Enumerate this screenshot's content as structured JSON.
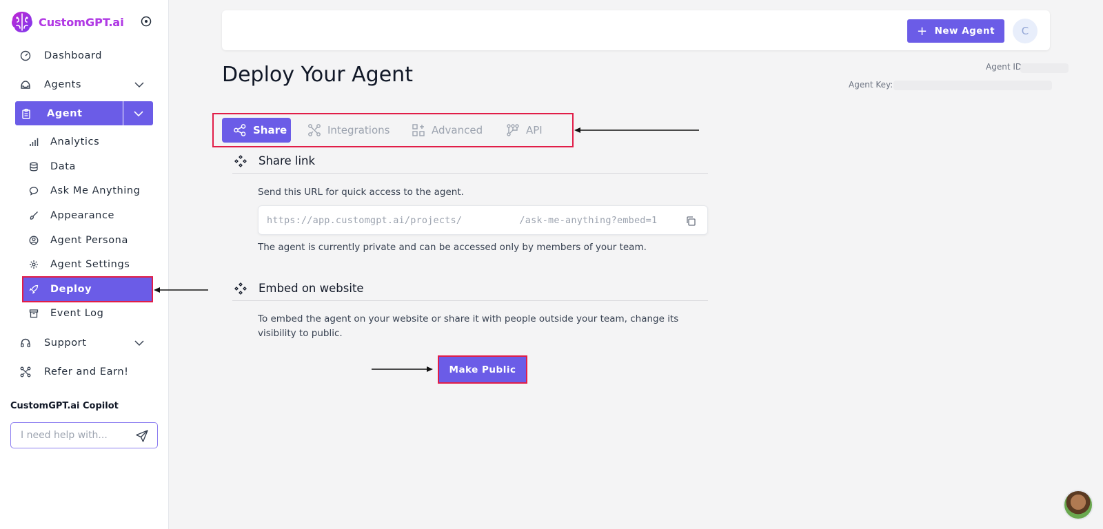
{
  "app": {
    "name": "CustomGPT.ai"
  },
  "sidebar": {
    "items": [
      {
        "label": "Dashboard",
        "icon": "dashboard-icon"
      },
      {
        "label": "Agents",
        "icon": "agents-icon"
      },
      {
        "label": "Agent",
        "icon": "clipboard-icon"
      },
      {
        "label": "Support",
        "icon": "headset-icon"
      },
      {
        "label": "Refer and Earn!",
        "icon": "share-nodes-icon"
      }
    ],
    "subitems": [
      {
        "label": "Analytics",
        "icon": "bar-chart-icon"
      },
      {
        "label": "Data",
        "icon": "database-icon"
      },
      {
        "label": "Ask Me Anything",
        "icon": "chat-bubble-icon"
      },
      {
        "label": "Appearance",
        "icon": "brush-icon"
      },
      {
        "label": "Agent Persona",
        "icon": "user-circle-icon"
      },
      {
        "label": "Agent Settings",
        "icon": "gear-icon"
      },
      {
        "label": "Deploy",
        "icon": "rocket-icon",
        "active": true
      },
      {
        "label": "Event Log",
        "icon": "archive-icon"
      }
    ],
    "copilot": {
      "title": "CustomGPT.ai Copilot",
      "placeholder": "I need help with..."
    }
  },
  "header": {
    "new_agent_label": "New Agent",
    "avatar_initial": "C"
  },
  "page": {
    "title": "Deploy Your Agent",
    "agent_id_label": "Agent ID",
    "agent_key_label": "Agent Key:"
  },
  "tabs": [
    {
      "label": "Share",
      "icon": "share-icon",
      "active": true
    },
    {
      "label": "Integrations",
      "icon": "integrations-icon"
    },
    {
      "label": "Advanced",
      "icon": "widgets-icon"
    },
    {
      "label": "API",
      "icon": "api-icon"
    }
  ],
  "share_link": {
    "title": "Share link",
    "description": "Send this URL for quick access to the agent.",
    "url_prefix": "https://app.customgpt.ai/projects/",
    "url_suffix": "/ask-me-anything?embed=1",
    "note": "The agent is currently private and can be accessed only by members of your team."
  },
  "embed": {
    "title": "Embed on website",
    "description_line1": "To embed the agent on your website or share it with people outside your team, change its visibility to",
    "description_line2": "public.",
    "button_label": "Make Public"
  },
  "colors": {
    "accent": "#6b5ce7",
    "highlight": "#e11d48"
  }
}
